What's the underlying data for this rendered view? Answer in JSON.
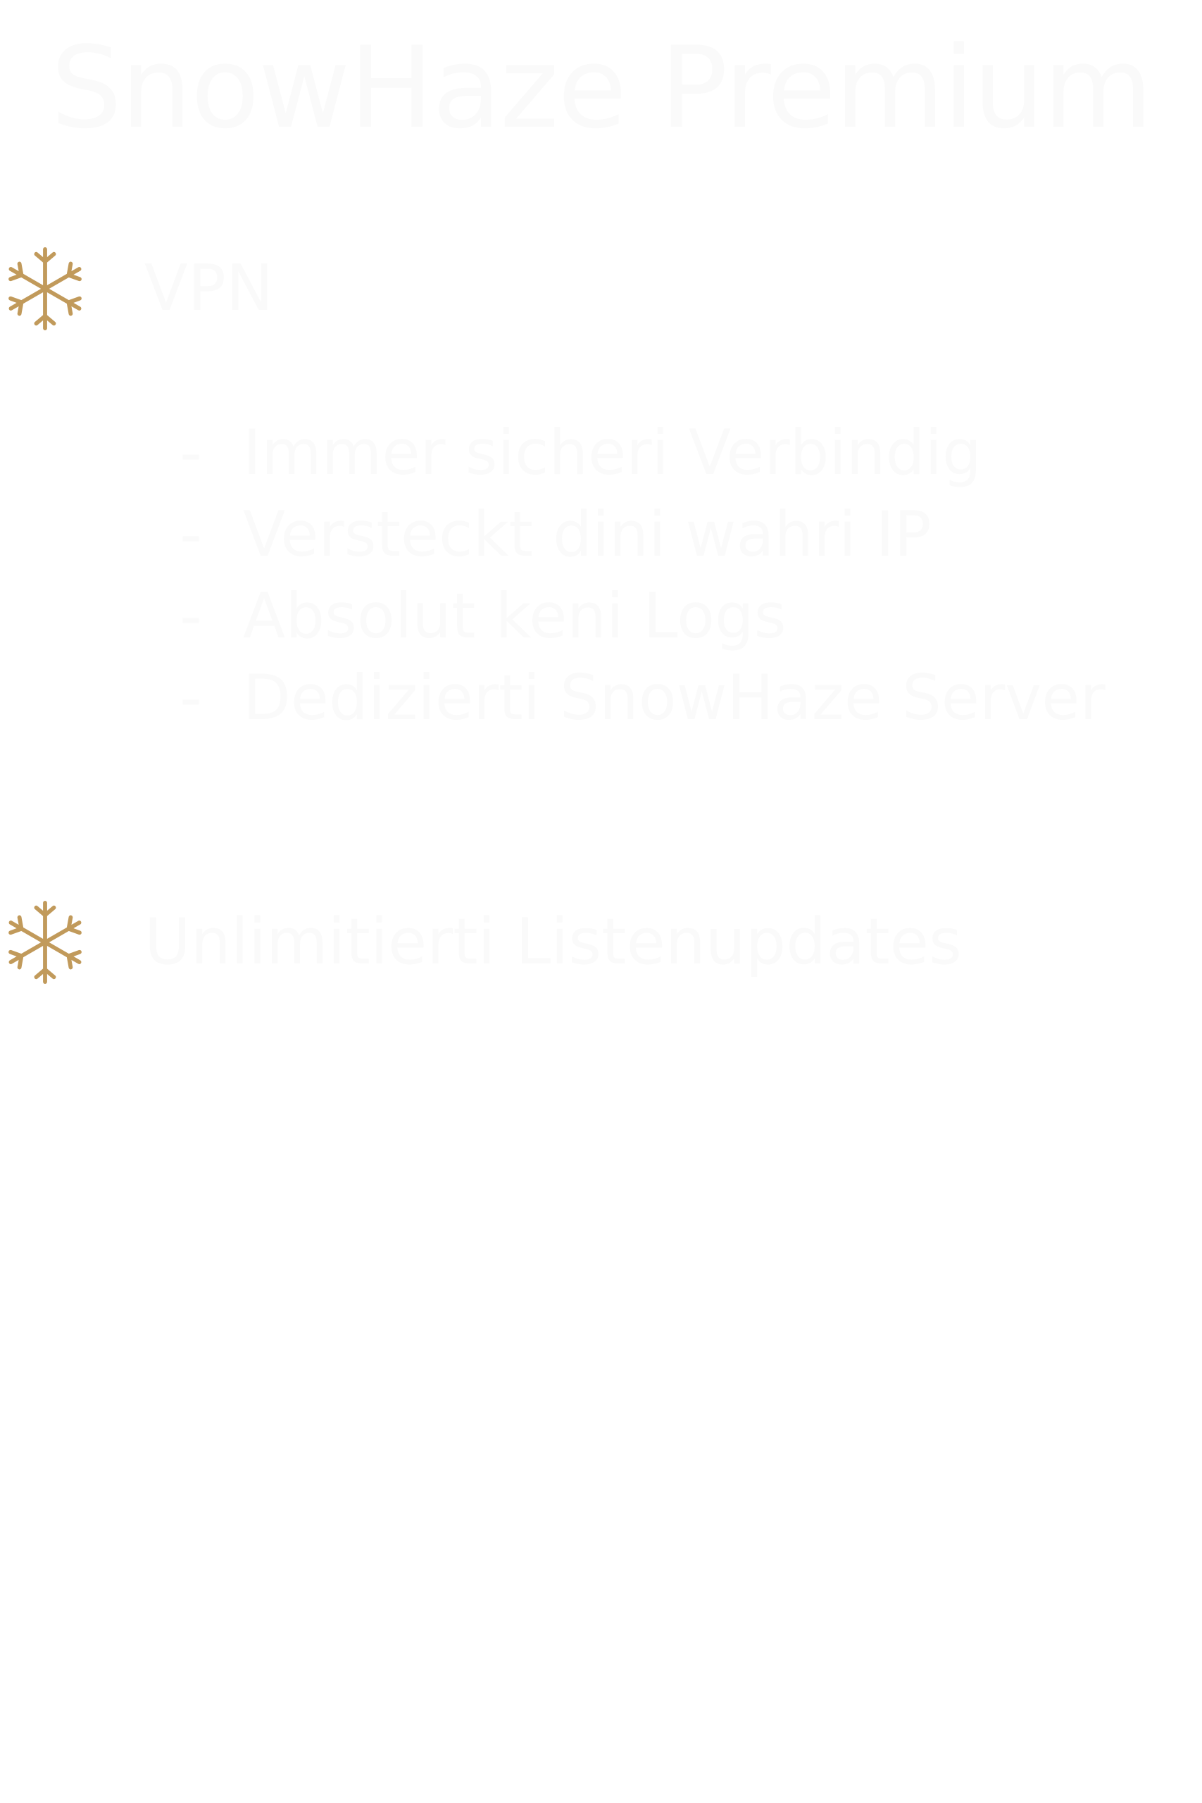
{
  "page": {
    "title": "SnowHaze Premium",
    "accent_color": "#c19a5b",
    "text_color": "#fafafa",
    "background_color": "#ffffff"
  },
  "features": [
    {
      "icon": "snowflake-icon",
      "title": "VPN",
      "bullets": [
        "Immer sicheri Verbindig",
        "Versteckt dini wahri IP",
        "Absolut keni Logs",
        "Dedizierti SnowHaze Server"
      ]
    },
    {
      "icon": "snowflake-icon",
      "title": "Unlimitierti Listenupdates",
      "bullets": []
    }
  ]
}
